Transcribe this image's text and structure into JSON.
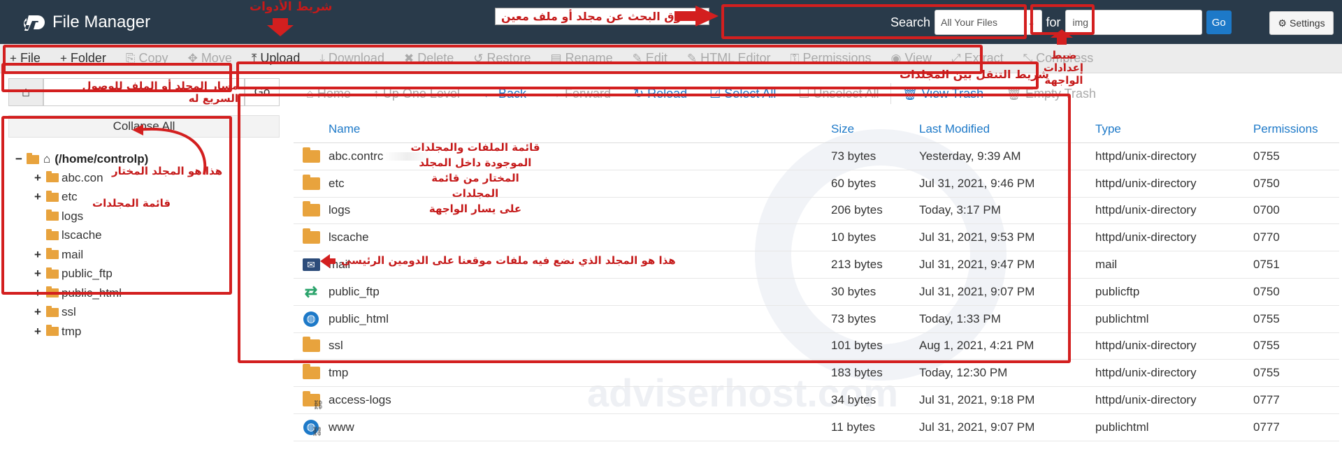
{
  "header": {
    "title": "File Manager",
    "settings_label": "Settings"
  },
  "search": {
    "label": "Search",
    "scope": "All Your Files",
    "for_label": "for",
    "query": "img",
    "go_label": "Go"
  },
  "toolbar": [
    {
      "label": "File",
      "icon": "+",
      "enabled": true
    },
    {
      "label": "Folder",
      "icon": "+",
      "enabled": true
    },
    {
      "label": "Copy",
      "icon": "⎘",
      "enabled": false
    },
    {
      "label": "Move",
      "icon": "✥",
      "enabled": false
    },
    {
      "label": "Upload",
      "icon": "⤒",
      "enabled": true
    },
    {
      "label": "Download",
      "icon": "⤓",
      "enabled": false
    },
    {
      "label": "Delete",
      "icon": "✖",
      "enabled": false
    },
    {
      "label": "Restore",
      "icon": "↺",
      "enabled": false
    },
    {
      "label": "Rename",
      "icon": "▤",
      "enabled": false
    },
    {
      "label": "Edit",
      "icon": "✎",
      "enabled": false
    },
    {
      "label": "HTML Editor",
      "icon": "✎",
      "enabled": false
    },
    {
      "label": "Permissions",
      "icon": "⚿",
      "enabled": false
    },
    {
      "label": "View",
      "icon": "◉",
      "enabled": false
    },
    {
      "label": "Extract",
      "icon": "⤢",
      "enabled": false
    },
    {
      "label": "Compress",
      "icon": "⤡",
      "enabled": false
    }
  ],
  "path": {
    "value": "مسار المجلد أو الملف للوصول السريع له",
    "go_label": "Go"
  },
  "collapse_all": "Collapse All",
  "tree": {
    "root": "(/home/controlp)",
    "items": [
      {
        "label": "abc.con",
        "toggle": "+"
      },
      {
        "label": "etc",
        "toggle": "+"
      },
      {
        "label": "logs",
        "toggle": ""
      },
      {
        "label": "lscache",
        "toggle": ""
      },
      {
        "label": "mail",
        "toggle": "+"
      },
      {
        "label": "public_ftp",
        "toggle": "+"
      },
      {
        "label": "public_html",
        "toggle": "+"
      },
      {
        "label": "ssl",
        "toggle": "+"
      },
      {
        "label": "tmp",
        "toggle": "+"
      }
    ]
  },
  "nav": [
    {
      "label": "Home",
      "icon": "⌂",
      "enabled": false
    },
    {
      "label": "Up One Level",
      "icon": "↑",
      "enabled": false
    },
    {
      "label": "Back",
      "icon": "←",
      "enabled": true
    },
    {
      "label": "Forward",
      "icon": "→",
      "enabled": false
    },
    {
      "label": "Reload",
      "icon": "↻",
      "enabled": true
    },
    {
      "label": "Select All",
      "icon": "☑",
      "enabled": true
    },
    {
      "label": "Unselect All",
      "icon": "☐",
      "enabled": false
    },
    {
      "label": "View Trash",
      "icon": "🗑",
      "enabled": true
    },
    {
      "label": "Empty Trash",
      "icon": "🗑",
      "enabled": false
    }
  ],
  "columns": [
    "Name",
    "Size",
    "Last Modified",
    "Type",
    "Permissions"
  ],
  "files": [
    {
      "icon": "folder",
      "name": "abc.contrc",
      "size": "73 bytes",
      "modified": "Yesterday, 9:39 AM",
      "type": "httpd/unix-directory",
      "perm": "0755"
    },
    {
      "icon": "folder",
      "name": "etc",
      "size": "60 bytes",
      "modified": "Jul 31, 2021, 9:46 PM",
      "type": "httpd/unix-directory",
      "perm": "0750"
    },
    {
      "icon": "folder",
      "name": "logs",
      "size": "206 bytes",
      "modified": "Today, 3:17 PM",
      "type": "httpd/unix-directory",
      "perm": "0700"
    },
    {
      "icon": "folder",
      "name": "lscache",
      "size": "10 bytes",
      "modified": "Jul 31, 2021, 9:53 PM",
      "type": "httpd/unix-directory",
      "perm": "0770"
    },
    {
      "icon": "mail",
      "name": "mail",
      "size": "213 bytes",
      "modified": "Jul 31, 2021, 9:47 PM",
      "type": "mail",
      "perm": "0751"
    },
    {
      "icon": "ftp",
      "name": "public_ftp",
      "size": "30 bytes",
      "modified": "Jul 31, 2021, 9:07 PM",
      "type": "publicftp",
      "perm": "0750"
    },
    {
      "icon": "globe",
      "name": "public_html",
      "size": "73 bytes",
      "modified": "Today, 1:33 PM",
      "type": "publichtml",
      "perm": "0755"
    },
    {
      "icon": "folder",
      "name": "ssl",
      "size": "101 bytes",
      "modified": "Aug 1, 2021, 4:21 PM",
      "type": "httpd/unix-directory",
      "perm": "0755"
    },
    {
      "icon": "folder",
      "name": "tmp",
      "size": "183 bytes",
      "modified": "Today, 12:30 PM",
      "type": "httpd/unix-directory",
      "perm": "0755"
    },
    {
      "icon": "folder-link",
      "name": "access-logs",
      "size": "34 bytes",
      "modified": "Jul 31, 2021, 9:18 PM",
      "type": "httpd/unix-directory",
      "perm": "0777"
    },
    {
      "icon": "globe-link",
      "name": "www",
      "size": "11 bytes",
      "modified": "Jul 31, 2021, 9:07 PM",
      "type": "publichtml",
      "perm": "0777"
    }
  ],
  "annotations": {
    "toolbar": "شريط الأدوات",
    "search": "صندوق البحث عن مجلد أو ملف معين",
    "settings": "ضبط إعدادات الواجهة",
    "navbar": "شريط التنقل بين المجلدات",
    "file_list": [
      "قائمة الملفات والمجلدات",
      "الموجودة داخل المجلد",
      "المختار من قائمة المجلدات",
      "على يسار الواجهة"
    ],
    "selected": "هذا هو المجلد المختار",
    "folder_list": "قائمة المجلدات",
    "public_html": "هذا هو المجلد الذي نضع فيه ملفات موقعنا على الدومين الرئيسي"
  },
  "watermark": "adviserhost.com",
  "colors": {
    "header": "#293a4a",
    "accent": "#1d79c8",
    "folder": "#e8a33d",
    "annotation": "#d31f1f"
  }
}
